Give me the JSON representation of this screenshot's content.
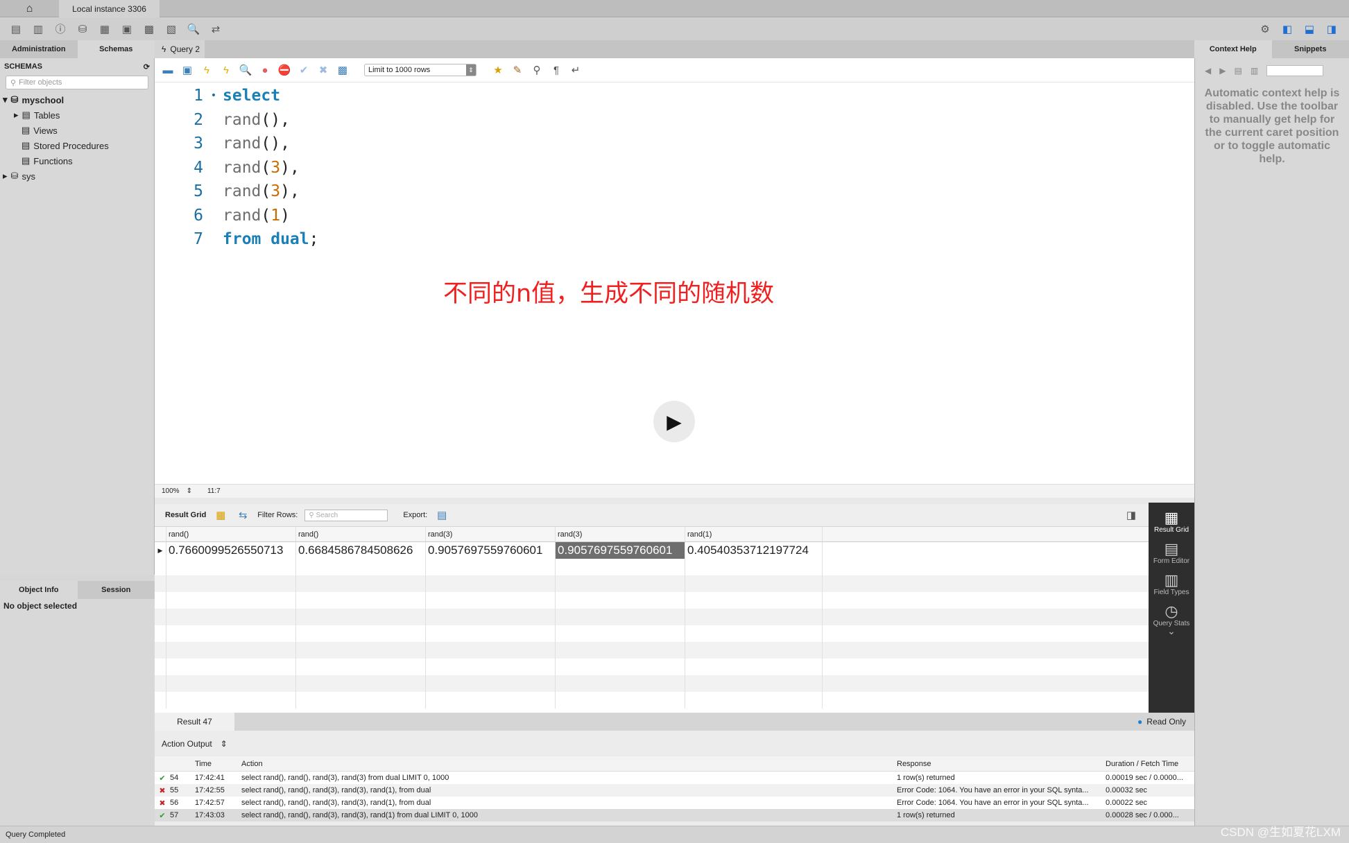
{
  "window": {
    "instance_tab": "Local instance 3306"
  },
  "left": {
    "tabs": [
      "Administration",
      "Schemas"
    ],
    "schemas_title": "SCHEMAS",
    "filter_placeholder": "Filter objects",
    "tree": [
      {
        "label": "myschool"
      },
      {
        "label": "Tables"
      },
      {
        "label": "Views"
      },
      {
        "label": "Stored Procedures"
      },
      {
        "label": "Functions"
      },
      {
        "label": "sys"
      }
    ],
    "obj_tabs": [
      "Object Info",
      "Session"
    ],
    "no_object": "No object selected"
  },
  "query_tab": "Query 2",
  "editor": {
    "limit": "Limit to 1000 rows",
    "lines": [
      {
        "n": "1",
        "parts": [
          {
            "t": "select",
            "k": "kw"
          }
        ]
      },
      {
        "n": "2",
        "parts": [
          {
            "t": "rand",
            "k": "fn"
          },
          {
            "t": "(),",
            "k": "p"
          }
        ]
      },
      {
        "n": "3",
        "parts": [
          {
            "t": "rand",
            "k": "fn"
          },
          {
            "t": "(),",
            "k": "p"
          }
        ]
      },
      {
        "n": "4",
        "parts": [
          {
            "t": "rand",
            "k": "fn"
          },
          {
            "t": "(",
            "k": "p"
          },
          {
            "t": "3",
            "k": "num"
          },
          {
            "t": "),",
            "k": "p"
          }
        ]
      },
      {
        "n": "5",
        "parts": [
          {
            "t": "rand",
            "k": "fn"
          },
          {
            "t": "(",
            "k": "p"
          },
          {
            "t": "3",
            "k": "num"
          },
          {
            "t": "),",
            "k": "p"
          }
        ]
      },
      {
        "n": "6",
        "parts": [
          {
            "t": "rand",
            "k": "fn"
          },
          {
            "t": "(",
            "k": "p"
          },
          {
            "t": "1",
            "k": "num"
          },
          {
            "t": ")",
            "k": "p"
          }
        ]
      },
      {
        "n": "7",
        "parts": [
          {
            "t": "from dual",
            "k": "kw"
          },
          {
            "t": ";",
            "k": "p"
          }
        ]
      }
    ],
    "annotation": "不同的n值，生成不同的随机数",
    "zoom": "100%",
    "cursor": "11:7"
  },
  "result": {
    "grid_label": "Result Grid",
    "filter_label": "Filter Rows:",
    "search_placeholder": "Search",
    "export_label": "Export:",
    "columns": [
      "rand()",
      "rand()",
      "rand(3)",
      "rand(3)",
      "rand(1)"
    ],
    "row": [
      "0.7660099526550713",
      "0.6684586784508626",
      "0.9057697559760601",
      "0.9057697559760601",
      "0.40540353712197724"
    ],
    "side": [
      "Result Grid",
      "Form Editor",
      "Field Types",
      "Query Stats"
    ],
    "tab": "Result 47",
    "read_only": "Read Only"
  },
  "output": {
    "title": "Action Output",
    "columns": [
      "",
      "Time",
      "Action",
      "Response",
      "Duration / Fetch Time"
    ],
    "rows": [
      {
        "status": "ok",
        "n": "54",
        "time": "17:42:41",
        "action": "select  rand(), rand(), rand(3), rand(3) from dual LIMIT 0, 1000",
        "response": "1 row(s) returned",
        "duration": "0.00019 sec / 0.0000..."
      },
      {
        "status": "error",
        "n": "55",
        "time": "17:42:55",
        "action": "select  rand(), rand(), rand(3), rand(3), rand(1), from dual",
        "response": "Error Code: 1064. You have an error in your SQL synta...",
        "duration": "0.00032 sec"
      },
      {
        "status": "error",
        "n": "56",
        "time": "17:42:57",
        "action": "select  rand(), rand(), rand(3), rand(3), rand(1), from dual",
        "response": "Error Code: 1064. You have an error in your SQL synta...",
        "duration": "0.00022 sec"
      },
      {
        "status": "ok",
        "n": "57",
        "time": "17:43:03",
        "action": "select  rand(), rand(), rand(3), rand(3), rand(1) from dual LIMIT 0, 1000",
        "response": "1 row(s) returned",
        "duration": "0.00028 sec / 0.000..."
      }
    ]
  },
  "right": {
    "tabs": [
      "Context Help",
      "Snippets"
    ],
    "help": "Automatic context help is disabled. Use the toolbar to manually get help for the current caret position or to toggle automatic help."
  },
  "status": "Query Completed",
  "watermark": "CSDN @生如夏花LXM"
}
